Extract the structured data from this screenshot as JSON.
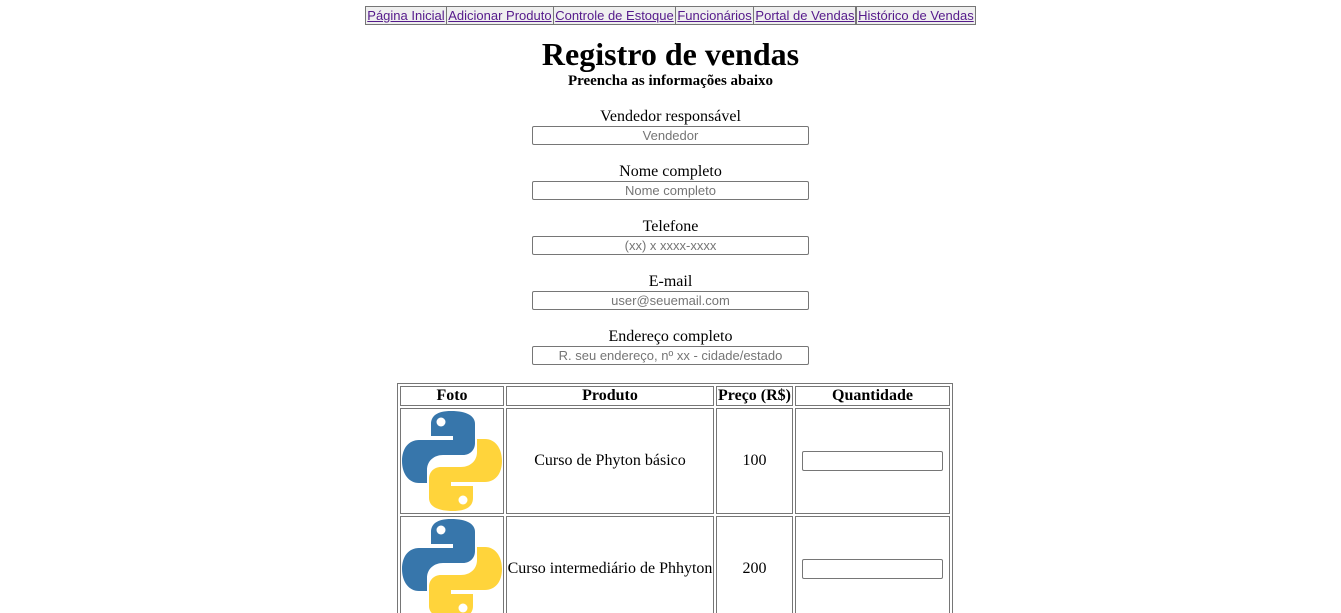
{
  "nav": {
    "items": [
      {
        "label": "Página Inicial"
      },
      {
        "label": "Adicionar Produto"
      },
      {
        "label": "Controle de Estoque"
      },
      {
        "label": "Funcionários"
      },
      {
        "label": "Portal de Vendas"
      },
      {
        "label": "Histórico de Vendas"
      }
    ]
  },
  "page": {
    "title": "Registro de vendas",
    "subtitle": "Preencha as informações abaixo"
  },
  "form": {
    "vendedor": {
      "label": "Vendedor responsável",
      "placeholder": "Vendedor",
      "value": ""
    },
    "nome": {
      "label": "Nome completo",
      "placeholder": "Nome completo",
      "value": ""
    },
    "telefone": {
      "label": "Telefone",
      "placeholder": "(xx) x xxxx-xxxx",
      "value": ""
    },
    "email": {
      "label": "E-mail",
      "placeholder": "user@seuemail.com",
      "value": ""
    },
    "endereco": {
      "label": "Endereço completo",
      "placeholder": "R. seu endereço, nº xx - cidade/estado",
      "value": ""
    }
  },
  "table": {
    "headers": [
      "Foto",
      "Produto",
      "Preço (R$)",
      "Quantidade"
    ],
    "rows": [
      {
        "image": "python-logo",
        "product": "Curso de Phyton básico",
        "price": "100",
        "quantity": ""
      },
      {
        "image": "python-logo",
        "product": "Curso intermediário de Phhyton",
        "price": "200",
        "quantity": ""
      }
    ]
  },
  "colors": {
    "link": "#551a8b",
    "python_blue": "#3776ab",
    "python_yellow": "#ffd43b"
  }
}
